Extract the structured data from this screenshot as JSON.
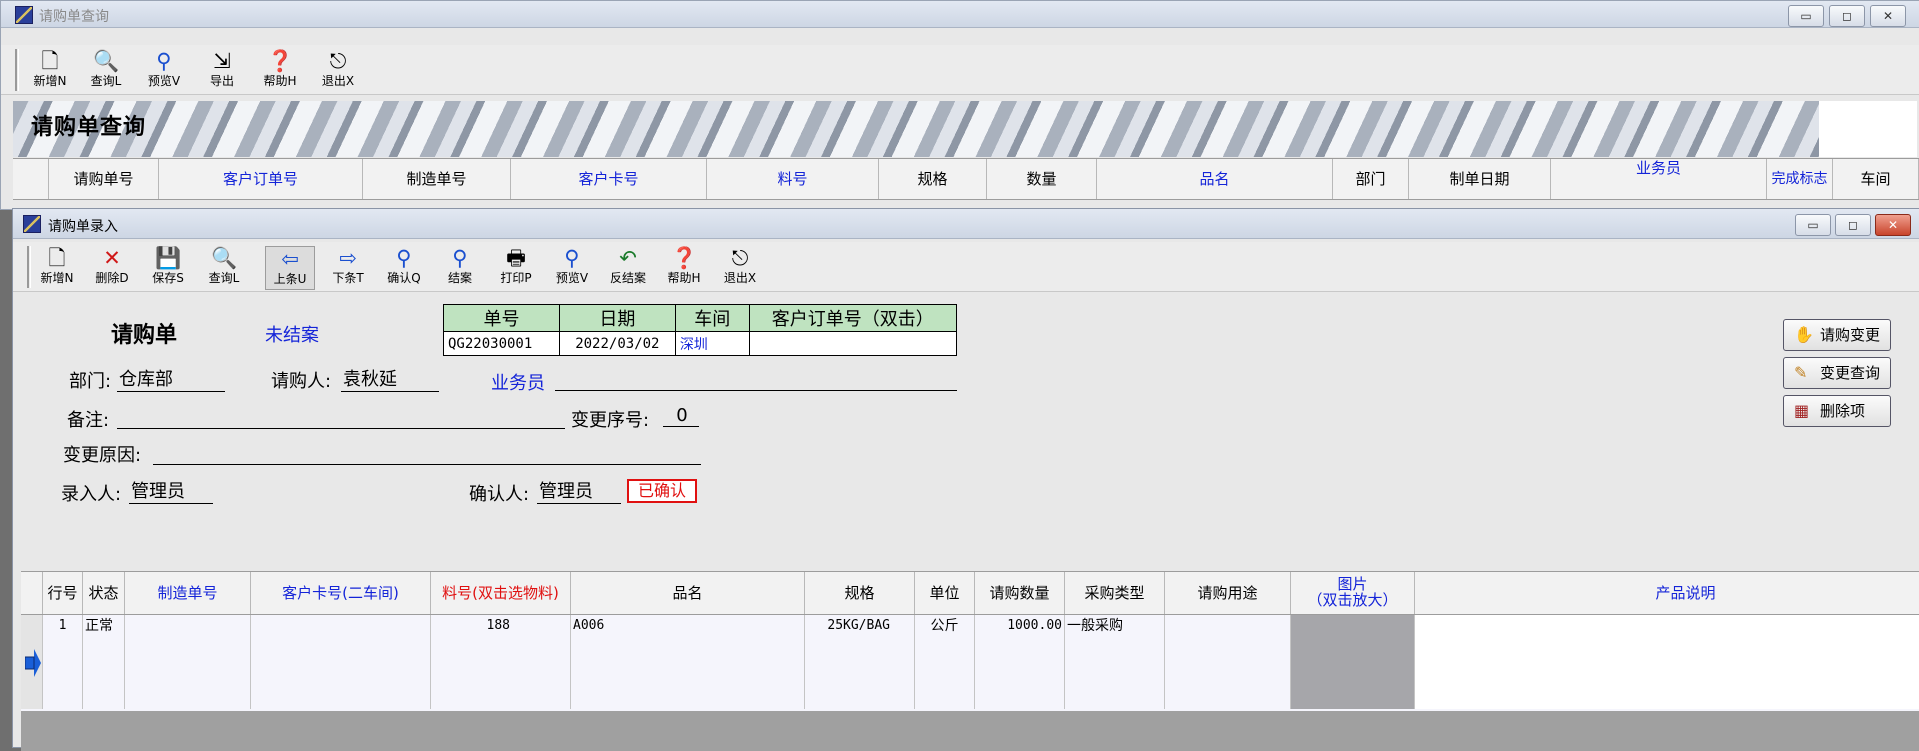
{
  "bg_window": {
    "title": "请购单查询",
    "toolbar": [
      {
        "label": "新增N",
        "icon": "new-doc-icon"
      },
      {
        "label": "查询L",
        "icon": "query-icon"
      },
      {
        "label": "预览V",
        "icon": "magnifier-icon"
      },
      {
        "label": "导出",
        "icon": "export-icon"
      },
      {
        "label": "帮助H",
        "icon": "help-icon"
      },
      {
        "label": "退出X",
        "icon": "exit-icon"
      }
    ],
    "banner_title": "请购单查询",
    "columns": [
      {
        "label": "",
        "color": "#000000"
      },
      {
        "label": "请购单号",
        "color": "#000000"
      },
      {
        "label": "客户订单号",
        "color": "#1424d8"
      },
      {
        "label": "制造单号",
        "color": "#000000"
      },
      {
        "label": "客户卡号",
        "color": "#1424d8"
      },
      {
        "label": "料号",
        "color": "#1424d8"
      },
      {
        "label": "规格",
        "color": "#000000"
      },
      {
        "label": "数量",
        "color": "#000000"
      },
      {
        "label": "品名",
        "color": "#1424d8"
      },
      {
        "label": "部门",
        "color": "#000000"
      },
      {
        "label": "制单日期",
        "color": "#000000"
      },
      {
        "label": "业务员",
        "color": "#1424d8"
      },
      {
        "label": "完成标志",
        "color": "#1424d8"
      },
      {
        "label": "车间",
        "color": "#000000"
      }
    ]
  },
  "fg_window": {
    "title": "请购单录入",
    "toolbar": [
      {
        "label": "新增N",
        "icon": "new-doc-icon"
      },
      {
        "label": "删除D",
        "icon": "delete-icon"
      },
      {
        "label": "保存S",
        "icon": "save-icon"
      },
      {
        "label": "查询L",
        "icon": "query-icon"
      },
      {
        "label": "上条U",
        "icon": "arrow-left-icon"
      },
      {
        "label": "下条T",
        "icon": "arrow-right-icon"
      },
      {
        "label": "确认Q",
        "icon": "magnifier-icon"
      },
      {
        "label": "结案",
        "icon": "magnifier-icon"
      },
      {
        "label": "打印P",
        "icon": "printer-icon"
      },
      {
        "label": "预览V",
        "icon": "magnifier-icon"
      },
      {
        "label": "反结案",
        "icon": "undo-icon"
      },
      {
        "label": "帮助H",
        "icon": "help-icon"
      },
      {
        "label": "退出X",
        "icon": "exit-icon"
      }
    ],
    "form_title": "请购单",
    "status": "未结案",
    "info_table": {
      "headers": [
        "单号",
        "日期",
        "车间",
        "客户订单号（双击）"
      ],
      "values": [
        "QG22030001",
        "2022/03/02",
        "深圳",
        ""
      ]
    },
    "dept_label": "部门:",
    "dept_value": "仓库部",
    "requester_label": "请购人:",
    "requester_value": "袁秋延",
    "salesman_label": "业务员",
    "salesman_value": "",
    "remark_label": "备注:",
    "remark_value": "",
    "change_seq_label": "变更序号:",
    "change_seq_value": "0",
    "change_reason_label": "变更原因:",
    "change_reason_value": "",
    "entry_label": "录入人:",
    "entry_value": "管理员",
    "confirm_label": "确认人:",
    "confirm_value": "管理员",
    "confirmed_stamp": "已确认",
    "side_buttons": [
      {
        "label": "请购变更",
        "icon": "handshake-icon"
      },
      {
        "label": "变更查询",
        "icon": "pen-icon"
      },
      {
        "label": "删除项",
        "icon": "grid-icon"
      }
    ],
    "grid": {
      "columns": [
        {
          "label": "",
          "color": "#000000"
        },
        {
          "label": "行号",
          "color": "#000000"
        },
        {
          "label": "状态",
          "color": "#000000"
        },
        {
          "label": "制造单号",
          "color": "#1424d8"
        },
        {
          "label": "客户卡号(二车间)",
          "color": "#1424d8"
        },
        {
          "label": "料号(双击选物料)",
          "color": "#e01010"
        },
        {
          "label": "品名",
          "color": "#000000"
        },
        {
          "label": "规格",
          "color": "#000000"
        },
        {
          "label": "单位",
          "color": "#000000"
        },
        {
          "label": "请购数量",
          "color": "#000000"
        },
        {
          "label": "采购类型",
          "color": "#000000"
        },
        {
          "label": "请购用途",
          "color": "#000000"
        },
        {
          "label": "图片\n（双击放大）",
          "color": "#1424d8"
        },
        {
          "label": "产品说明",
          "color": "#1424d8"
        }
      ],
      "rows": [
        [
          "",
          "1",
          "正常",
          "",
          "",
          "188",
          "A006",
          "25KG/BAG",
          "公斤",
          "1000.00",
          "一般采购",
          "",
          "",
          ""
        ]
      ]
    }
  }
}
